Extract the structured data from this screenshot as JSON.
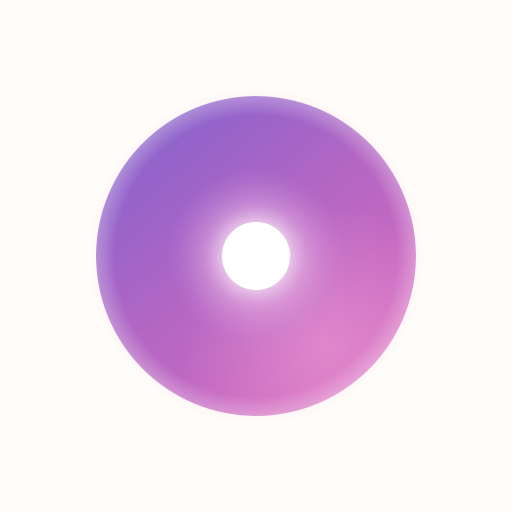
{
  "background_color": "#fffdf9",
  "icon": {
    "name": "ring-icon",
    "colors": {
      "violet": "#8a63cc",
      "purple": "#b366c4",
      "magenta": "#d86cbe",
      "pink_highlight": "#ee9fd6",
      "inner_glow": "#f3dcf2"
    }
  }
}
